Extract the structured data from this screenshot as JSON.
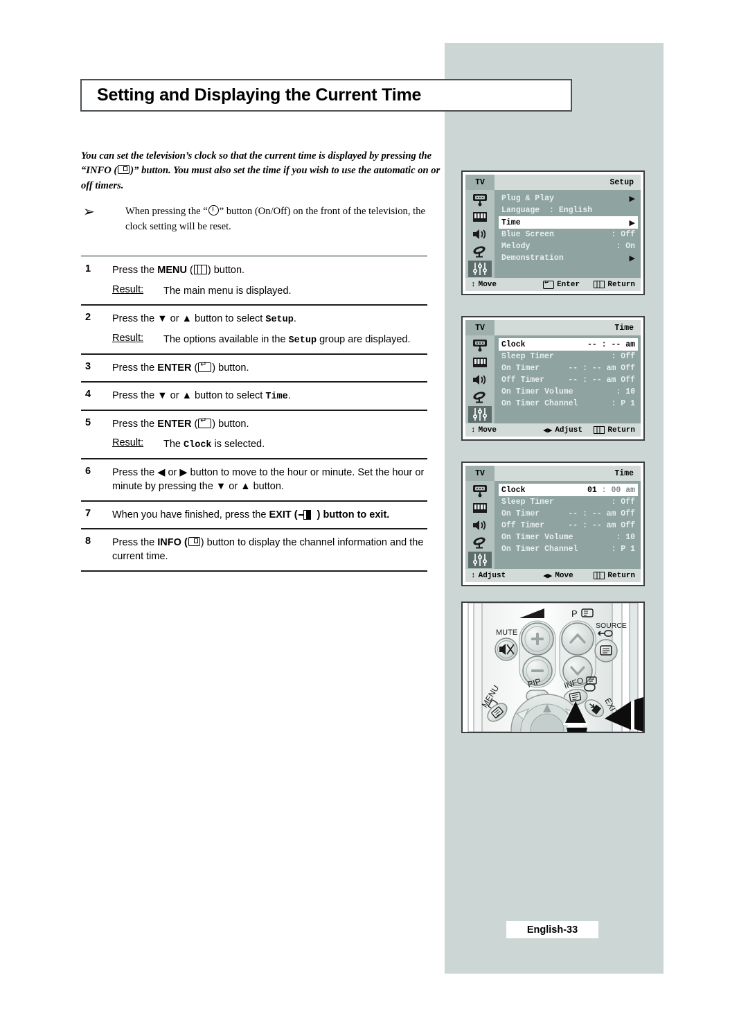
{
  "page": {
    "title": "Setting and Displaying the Current Time",
    "footer_label": "English-33",
    "colors": {
      "panel_bg": "#ccd6d4",
      "osd_bg": "#8fa3a0",
      "osd_icon_bar": "#b3c2bf",
      "osd_title_bar": "#d3dbd9",
      "osd_highlight": "#ffffff",
      "rule_dark": "#1b1b1b",
      "rule_light": "#b9bfbf"
    }
  },
  "intro": {
    "line1_a": "You can set the television’s clock so that the current time is displayed",
    "line1_b": "by pressing the “INFO (",
    "line1_c": ")” button. You must also set the time if",
    "line1_d": "you wish to use the automatic on or off timers."
  },
  "note": {
    "bullet": "➢",
    "text_a": "When pressing the “",
    "text_b": "” button (On/Off) on the front of the television, the clock setting will be reset."
  },
  "steps": [
    {
      "num": "1",
      "text_a": "Press the ",
      "bold": "MENU",
      "text_b": " (",
      "text_c": ") button.",
      "result_label": "Result:",
      "result_text": "The main menu is displayed."
    },
    {
      "num": "2",
      "text_a": "Press the ▼ or ▲ button to select ",
      "mono": "Setup",
      "text_b": ".",
      "result_label": "Result:",
      "result_text_a": "The options available in the ",
      "result_mono": "Setup",
      "result_text_b": " group are displayed."
    },
    {
      "num": "3",
      "text_a": "Press the ",
      "bold": "ENTER",
      "text_b": " (",
      "text_c": ") button."
    },
    {
      "num": "4",
      "text_a": "Press the ▼ or ▲ button to select ",
      "mono": "Time",
      "text_b": "."
    },
    {
      "num": "5",
      "text_a": "Press the ",
      "bold": "ENTER",
      "text_b": " (",
      "text_c": ") button.",
      "result_label": "Result:",
      "result_text_a": "The ",
      "result_mono": "Clock",
      "result_text_b": " is selected."
    },
    {
      "num": "6",
      "text_a": "Press the ◀ or ▶ button to move to the hour or minute. Set the hour or minute by pressing the ▼ or ▲ button."
    },
    {
      "num": "7",
      "text_a": "When you have finished, press the ",
      "bold": "EXIT",
      "text_b": " (",
      "text_c": " ) button to exit."
    },
    {
      "num": "8",
      "text_a": "Press the ",
      "bold": "INFO",
      "text_b": " (",
      "text_c": ") button to display the channel information and the current time."
    }
  ],
  "osd_menus": [
    {
      "id": "setup-menu",
      "source_label": "TV",
      "title": "Setup",
      "rows": [
        {
          "label": "Plug & Play",
          "value": "",
          "arrow": "▶",
          "highlight": false
        },
        {
          "label": "Language  : English",
          "value": "",
          "arrow": "",
          "highlight": false
        },
        {
          "label": "Time",
          "value": "",
          "arrow": "▶",
          "highlight": true
        },
        {
          "label": "Blue Screen",
          "value": ": Off",
          "arrow": "",
          "highlight": false
        },
        {
          "label": "Melody",
          "value": ": On",
          "arrow": "",
          "highlight": false
        },
        {
          "label": "Demonstration",
          "value": "",
          "arrow": "▶",
          "highlight": false
        }
      ],
      "footer": [
        {
          "icon": "↕",
          "label": "Move"
        },
        {
          "icon": "enter",
          "label": "Enter"
        },
        {
          "icon": "menu",
          "label": "Return"
        }
      ]
    },
    {
      "id": "time-menu-empty",
      "source_label": "TV",
      "title": "Time",
      "rows": [
        {
          "label": "Clock",
          "value": "-- : -- am",
          "arrow": "",
          "highlight": true
        },
        {
          "label": "Sleep Timer",
          "value": ": Off",
          "arrow": "",
          "highlight": false
        },
        {
          "label": "On Timer",
          "value": "-- : -- am Off",
          "arrow": "",
          "highlight": false
        },
        {
          "label": "Off Timer",
          "value": "-- : -- am Off",
          "arrow": "",
          "highlight": false
        },
        {
          "label": "On Timer Volume",
          "value": ": 10",
          "arrow": "",
          "highlight": false
        },
        {
          "label": "On Timer Channel",
          "value": ": P 1",
          "arrow": "",
          "highlight": false
        }
      ],
      "footer": [
        {
          "icon": "↕",
          "label": "Move"
        },
        {
          "icon": "◀▶",
          "label": "Adjust"
        },
        {
          "icon": "menu",
          "label": "Return"
        }
      ]
    },
    {
      "id": "time-menu-set",
      "source_label": "TV",
      "title": "Time",
      "rows": [
        {
          "label": "Clock",
          "value": "01 : 00 am",
          "value_hour": "01",
          "value_rest": " : 00 am",
          "arrow": "",
          "highlight": true
        },
        {
          "label": "Sleep Timer",
          "value": ": Off",
          "arrow": "",
          "highlight": false
        },
        {
          "label": "On Timer",
          "value": "-- : -- am Off",
          "arrow": "",
          "highlight": false
        },
        {
          "label": "Off Timer",
          "value": "-- : -- am Off",
          "arrow": "",
          "highlight": false
        },
        {
          "label": "On Timer Volume",
          "value": ": 10",
          "arrow": "",
          "highlight": false
        },
        {
          "label": "On Timer Channel",
          "value": ": P 1",
          "arrow": "",
          "highlight": false
        }
      ],
      "footer": [
        {
          "icon": "↕",
          "label": "Adjust"
        },
        {
          "icon": "◀▶",
          "label": "Move"
        },
        {
          "icon": "menu",
          "label": "Return"
        }
      ]
    }
  ],
  "remote": {
    "labels": {
      "mute": "MUTE",
      "program": "P",
      "source": "SOURCE",
      "pip": "PIP",
      "info": "INFO",
      "menu": "MENU",
      "exit": "EXIT",
      "channel_up": "⌃P"
    }
  }
}
